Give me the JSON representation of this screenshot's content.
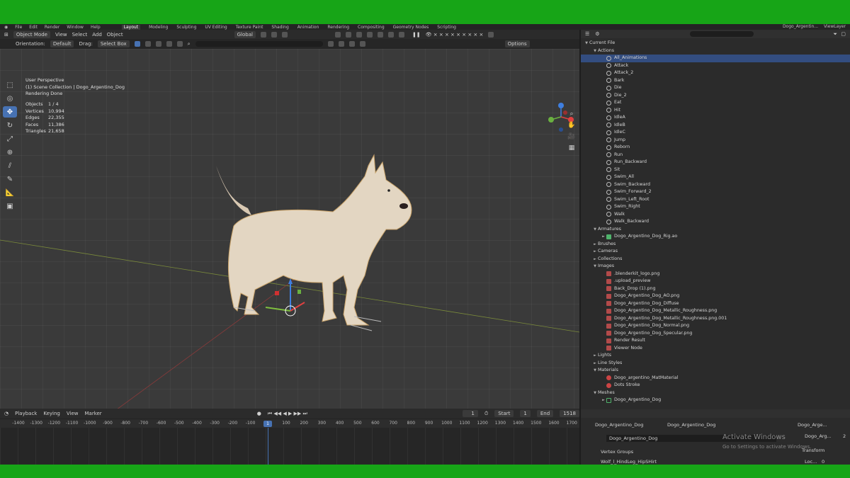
{
  "topbar": {
    "menus": [
      "File",
      "Edit",
      "Render",
      "Window",
      "Help"
    ],
    "workspaces": [
      "Layout",
      "Modeling",
      "Sculpting",
      "UV Editing",
      "Texture Paint",
      "Shading",
      "Animation",
      "Rendering",
      "Compositing",
      "Geometry Nodes",
      "Scripting"
    ],
    "active": "Layout",
    "scene": "Dogo_Argentin...",
    "viewlayer": "ViewLayer"
  },
  "vp_header": {
    "mode": "Object Mode",
    "menus": [
      "View",
      "Select",
      "Add",
      "Object"
    ],
    "orientation_label": "Orientation:",
    "orientation_value": "Default",
    "drag_label": "Drag:",
    "drag_value": "Select Box",
    "transform": "Global",
    "options": "Options"
  },
  "overlay": {
    "line1": "User Perspective",
    "line2": "(1) Scene Collection | Dogo_Argentino_Dog",
    "line3": "Rendering Done"
  },
  "stats": [
    {
      "k": "Objects",
      "v": "1 / 4"
    },
    {
      "k": "Vertices",
      "v": "10,994"
    },
    {
      "k": "Edges",
      "v": "22,355"
    },
    {
      "k": "Faces",
      "v": "11,386"
    },
    {
      "k": "Triangles",
      "v": "21,658"
    }
  ],
  "outliner": {
    "rows": [
      {
        "t": "Current File",
        "d": 0,
        "tri": "▼",
        "icon": ""
      },
      {
        "t": "Actions",
        "d": 1,
        "tri": "▼",
        "icon": ""
      },
      {
        "t": "All_Animations",
        "d": 2,
        "icon": "action",
        "sel": true
      },
      {
        "t": "Attack",
        "d": 2,
        "icon": "action"
      },
      {
        "t": "Attack_2",
        "d": 2,
        "icon": "action"
      },
      {
        "t": "Bark",
        "d": 2,
        "icon": "action"
      },
      {
        "t": "Die",
        "d": 2,
        "icon": "action"
      },
      {
        "t": "Die_2",
        "d": 2,
        "icon": "action"
      },
      {
        "t": "Eat",
        "d": 2,
        "icon": "action"
      },
      {
        "t": "Hit",
        "d": 2,
        "icon": "action"
      },
      {
        "t": "IdleA",
        "d": 2,
        "icon": "action"
      },
      {
        "t": "IdleB",
        "d": 2,
        "icon": "action"
      },
      {
        "t": "IdleC",
        "d": 2,
        "icon": "action"
      },
      {
        "t": "Jump",
        "d": 2,
        "icon": "action"
      },
      {
        "t": "Reborn",
        "d": 2,
        "icon": "action"
      },
      {
        "t": "Run",
        "d": 2,
        "icon": "action"
      },
      {
        "t": "Run_Backward",
        "d": 2,
        "icon": "action"
      },
      {
        "t": "Sit",
        "d": 2,
        "icon": "action"
      },
      {
        "t": "Swim_All",
        "d": 2,
        "icon": "action"
      },
      {
        "t": "Swim_Backward",
        "d": 2,
        "icon": "action"
      },
      {
        "t": "Swim_Forward_2",
        "d": 2,
        "icon": "action"
      },
      {
        "t": "Swim_Left_Root",
        "d": 2,
        "icon": "action"
      },
      {
        "t": "Swim_Right",
        "d": 2,
        "icon": "action"
      },
      {
        "t": "Walk",
        "d": 2,
        "icon": "action"
      },
      {
        "t": "Walk_Backward",
        "d": 2,
        "icon": "action"
      },
      {
        "t": "Armatures",
        "d": 1,
        "tri": "▼",
        "icon": ""
      },
      {
        "t": "Dogo_Argentino_Dog_Rig.ao",
        "d": 2,
        "tri": "►",
        "icon": "arm"
      },
      {
        "t": "Brushes",
        "d": 1,
        "tri": "►",
        "icon": ""
      },
      {
        "t": "Cameras",
        "d": 1,
        "tri": "►",
        "icon": ""
      },
      {
        "t": "Collections",
        "d": 1,
        "tri": "►",
        "icon": ""
      },
      {
        "t": "Images",
        "d": 1,
        "tri": "▼",
        "icon": ""
      },
      {
        "t": ".blenderkit_logo.png",
        "d": 2,
        "icon": "img"
      },
      {
        "t": ".upload_preview",
        "d": 2,
        "icon": "img"
      },
      {
        "t": "Back_Drop (1).png",
        "d": 2,
        "icon": "img"
      },
      {
        "t": "Dogo_Argentino_Dog_AO.png",
        "d": 2,
        "icon": "img"
      },
      {
        "t": "Dogo_Argentino_Dog_Diffuse",
        "d": 2,
        "icon": "img"
      },
      {
        "t": "Dogo_Argentino_Dog_Metallic_Roughness.png",
        "d": 2,
        "icon": "img"
      },
      {
        "t": "Dogo_Argentino_Dog_Metallic_Roughness.png.001",
        "d": 2,
        "icon": "img"
      },
      {
        "t": "Dogo_Argentino_Dog_Normal.png",
        "d": 2,
        "icon": "img"
      },
      {
        "t": "Dogo_Argentino_Dog_Specular.png",
        "d": 2,
        "icon": "img"
      },
      {
        "t": "Render Result",
        "d": 2,
        "icon": "img"
      },
      {
        "t": "Viewer Node",
        "d": 2,
        "icon": "img"
      },
      {
        "t": "Lights",
        "d": 1,
        "tri": "►",
        "icon": ""
      },
      {
        "t": "Line Styles",
        "d": 1,
        "tri": "►",
        "icon": ""
      },
      {
        "t": "Materials",
        "d": 1,
        "tri": "▼",
        "icon": ""
      },
      {
        "t": "Dogo_argentino_MatMaterial",
        "d": 2,
        "icon": "mat"
      },
      {
        "t": "Dots Stroke",
        "d": 2,
        "icon": "mat"
      },
      {
        "t": "Meshes",
        "d": 1,
        "tri": "▼",
        "icon": ""
      },
      {
        "t": "Dogo_Argentino_Dog",
        "d": 2,
        "tri": "►",
        "icon": "mesh"
      }
    ]
  },
  "timeline": {
    "menus": [
      "Playback",
      "Keying",
      "View",
      "Marker"
    ],
    "current": "1",
    "start_label": "Start",
    "start": "1",
    "end_label": "End",
    "end": "1518",
    "ticks": [
      "-1400",
      "-1300",
      "-1200",
      "-1100",
      "-1000",
      "-900",
      "-800",
      "-700",
      "-600",
      "-500",
      "-400",
      "-300",
      "-200",
      "-100",
      "1",
      "100",
      "200",
      "300",
      "400",
      "500",
      "600",
      "700",
      "800",
      "900",
      "1000",
      "1100",
      "1200",
      "1300",
      "1400",
      "1500",
      "1600",
      "1700"
    ]
  },
  "props": {
    "obj1": "Dogo_Argentino_Dog",
    "obj2": "Dogo_Argentino_Dog",
    "mesh_field": "Dogo_Argentino_Dog",
    "vertex_groups": "Vertex Groups",
    "vg_item": "Wolf_l_HindLeg_HipSHirt",
    "right_obj": "Dogo_Arge...",
    "right_field": "Dogo_Arg...",
    "right_num": "2",
    "transform": "Transform",
    "loc": "Loc...",
    "loc_val": "0"
  },
  "watermark": {
    "title": "Activate Windows",
    "sub": "Go to Settings to activate Windows."
  }
}
